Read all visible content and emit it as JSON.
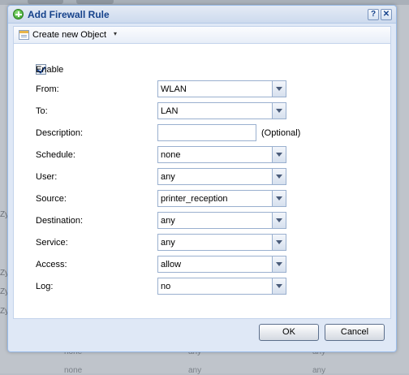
{
  "background": {
    "z_labels": [
      "Zy",
      "Zy",
      "Zy",
      "Zy"
    ],
    "rows": [
      {
        "schedule": "none",
        "user": "any",
        "service": "any"
      },
      {
        "schedule": "none",
        "user": "any",
        "service": "any"
      },
      {
        "schedule": "none",
        "user": "any",
        "service": "any"
      }
    ]
  },
  "dialog": {
    "title": "Add Firewall Rule",
    "help_label": "?",
    "close_label": "✕"
  },
  "toolbar": {
    "create_label": "Create new Object",
    "caret": "▾"
  },
  "form": {
    "enable": {
      "label": "Enable",
      "checked": true
    },
    "from": {
      "label": "From:",
      "value": "WLAN"
    },
    "to": {
      "label": "To:",
      "value": "LAN"
    },
    "description": {
      "label": "Description:",
      "value": "",
      "hint": "(Optional)"
    },
    "schedule": {
      "label": "Schedule:",
      "value": "none"
    },
    "user": {
      "label": "User:",
      "value": "any"
    },
    "source": {
      "label": "Source:",
      "value": "printer_reception"
    },
    "destination": {
      "label": "Destination:",
      "value": "any"
    },
    "service": {
      "label": "Service:",
      "value": "any"
    },
    "access": {
      "label": "Access:",
      "value": "allow"
    },
    "log": {
      "label": "Log:",
      "value": "no"
    }
  },
  "buttons": {
    "ok": "OK",
    "cancel": "Cancel"
  },
  "colors": {
    "title_text": "#15428b",
    "dialog_bg": "#dfe8f6",
    "border": "#99bbe8"
  }
}
